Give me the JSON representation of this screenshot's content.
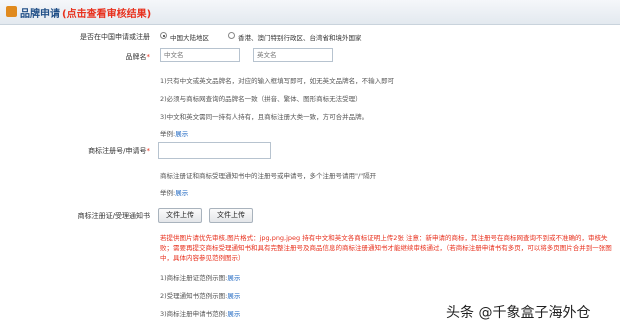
{
  "header": {
    "title": "品牌申请",
    "link": "(点击查看审核结果)"
  },
  "region": {
    "label": "是否在中国申请或注册",
    "options": [
      "中国大陆地区",
      "香港、澳门特别行政区、台湾省和境外国家"
    ],
    "selected": "中国大陆地区"
  },
  "brand": {
    "label": "品牌名",
    "required": "*",
    "cn_placeholder": "中文名",
    "en_placeholder": "英文名",
    "notes": [
      "1)只有中文或英文品牌名，对应的输入框填写即可，如无英文品牌名，不输入即可",
      "2)必须与商标网查询的品牌名一致（拼音、繁体、图形商标无法受理）",
      "3)中文和英文需同一持有人持有，且商标注册大类一致，方可合并品牌。"
    ],
    "example_label": "举例:",
    "example_link": "展示"
  },
  "trademark_no": {
    "label": "商标注册号/申请号",
    "required": "*",
    "note": "商标注册证和商标受理通知书中的注册号或申请号，多个注册号请用\"/\"隔开",
    "example_label": "举例:",
    "example_link": "展示"
  },
  "certificate": {
    "label": "商标注册证/受理通知书",
    "buttons": [
      "文件上传",
      "文件上传"
    ],
    "warning": "若提供图片请优先审核,图片格式：jpg,png,jpeg 持有中文和英文各商标证明上传2张 注意：新申请的商标，其注册号在商标网查询不到或不准确的，审核失败；需要再提交商标受理通知书和具有完整注册号及商品信息的商标注册通知书才能继续审核通过，（若商标注册申请书有多页，可以将多页图片合并到一张图中，具体内容参见范例图示）",
    "examples": [
      {
        "label": "1)商标注册证范例示图:",
        "link": "展示"
      },
      {
        "label": "2)受理通知书范例示图:",
        "link": "展示"
      },
      {
        "label": "3)商标注册申请书范例:",
        "link": "展示"
      }
    ]
  },
  "watermark": "头条 @千象盒子海外仓"
}
